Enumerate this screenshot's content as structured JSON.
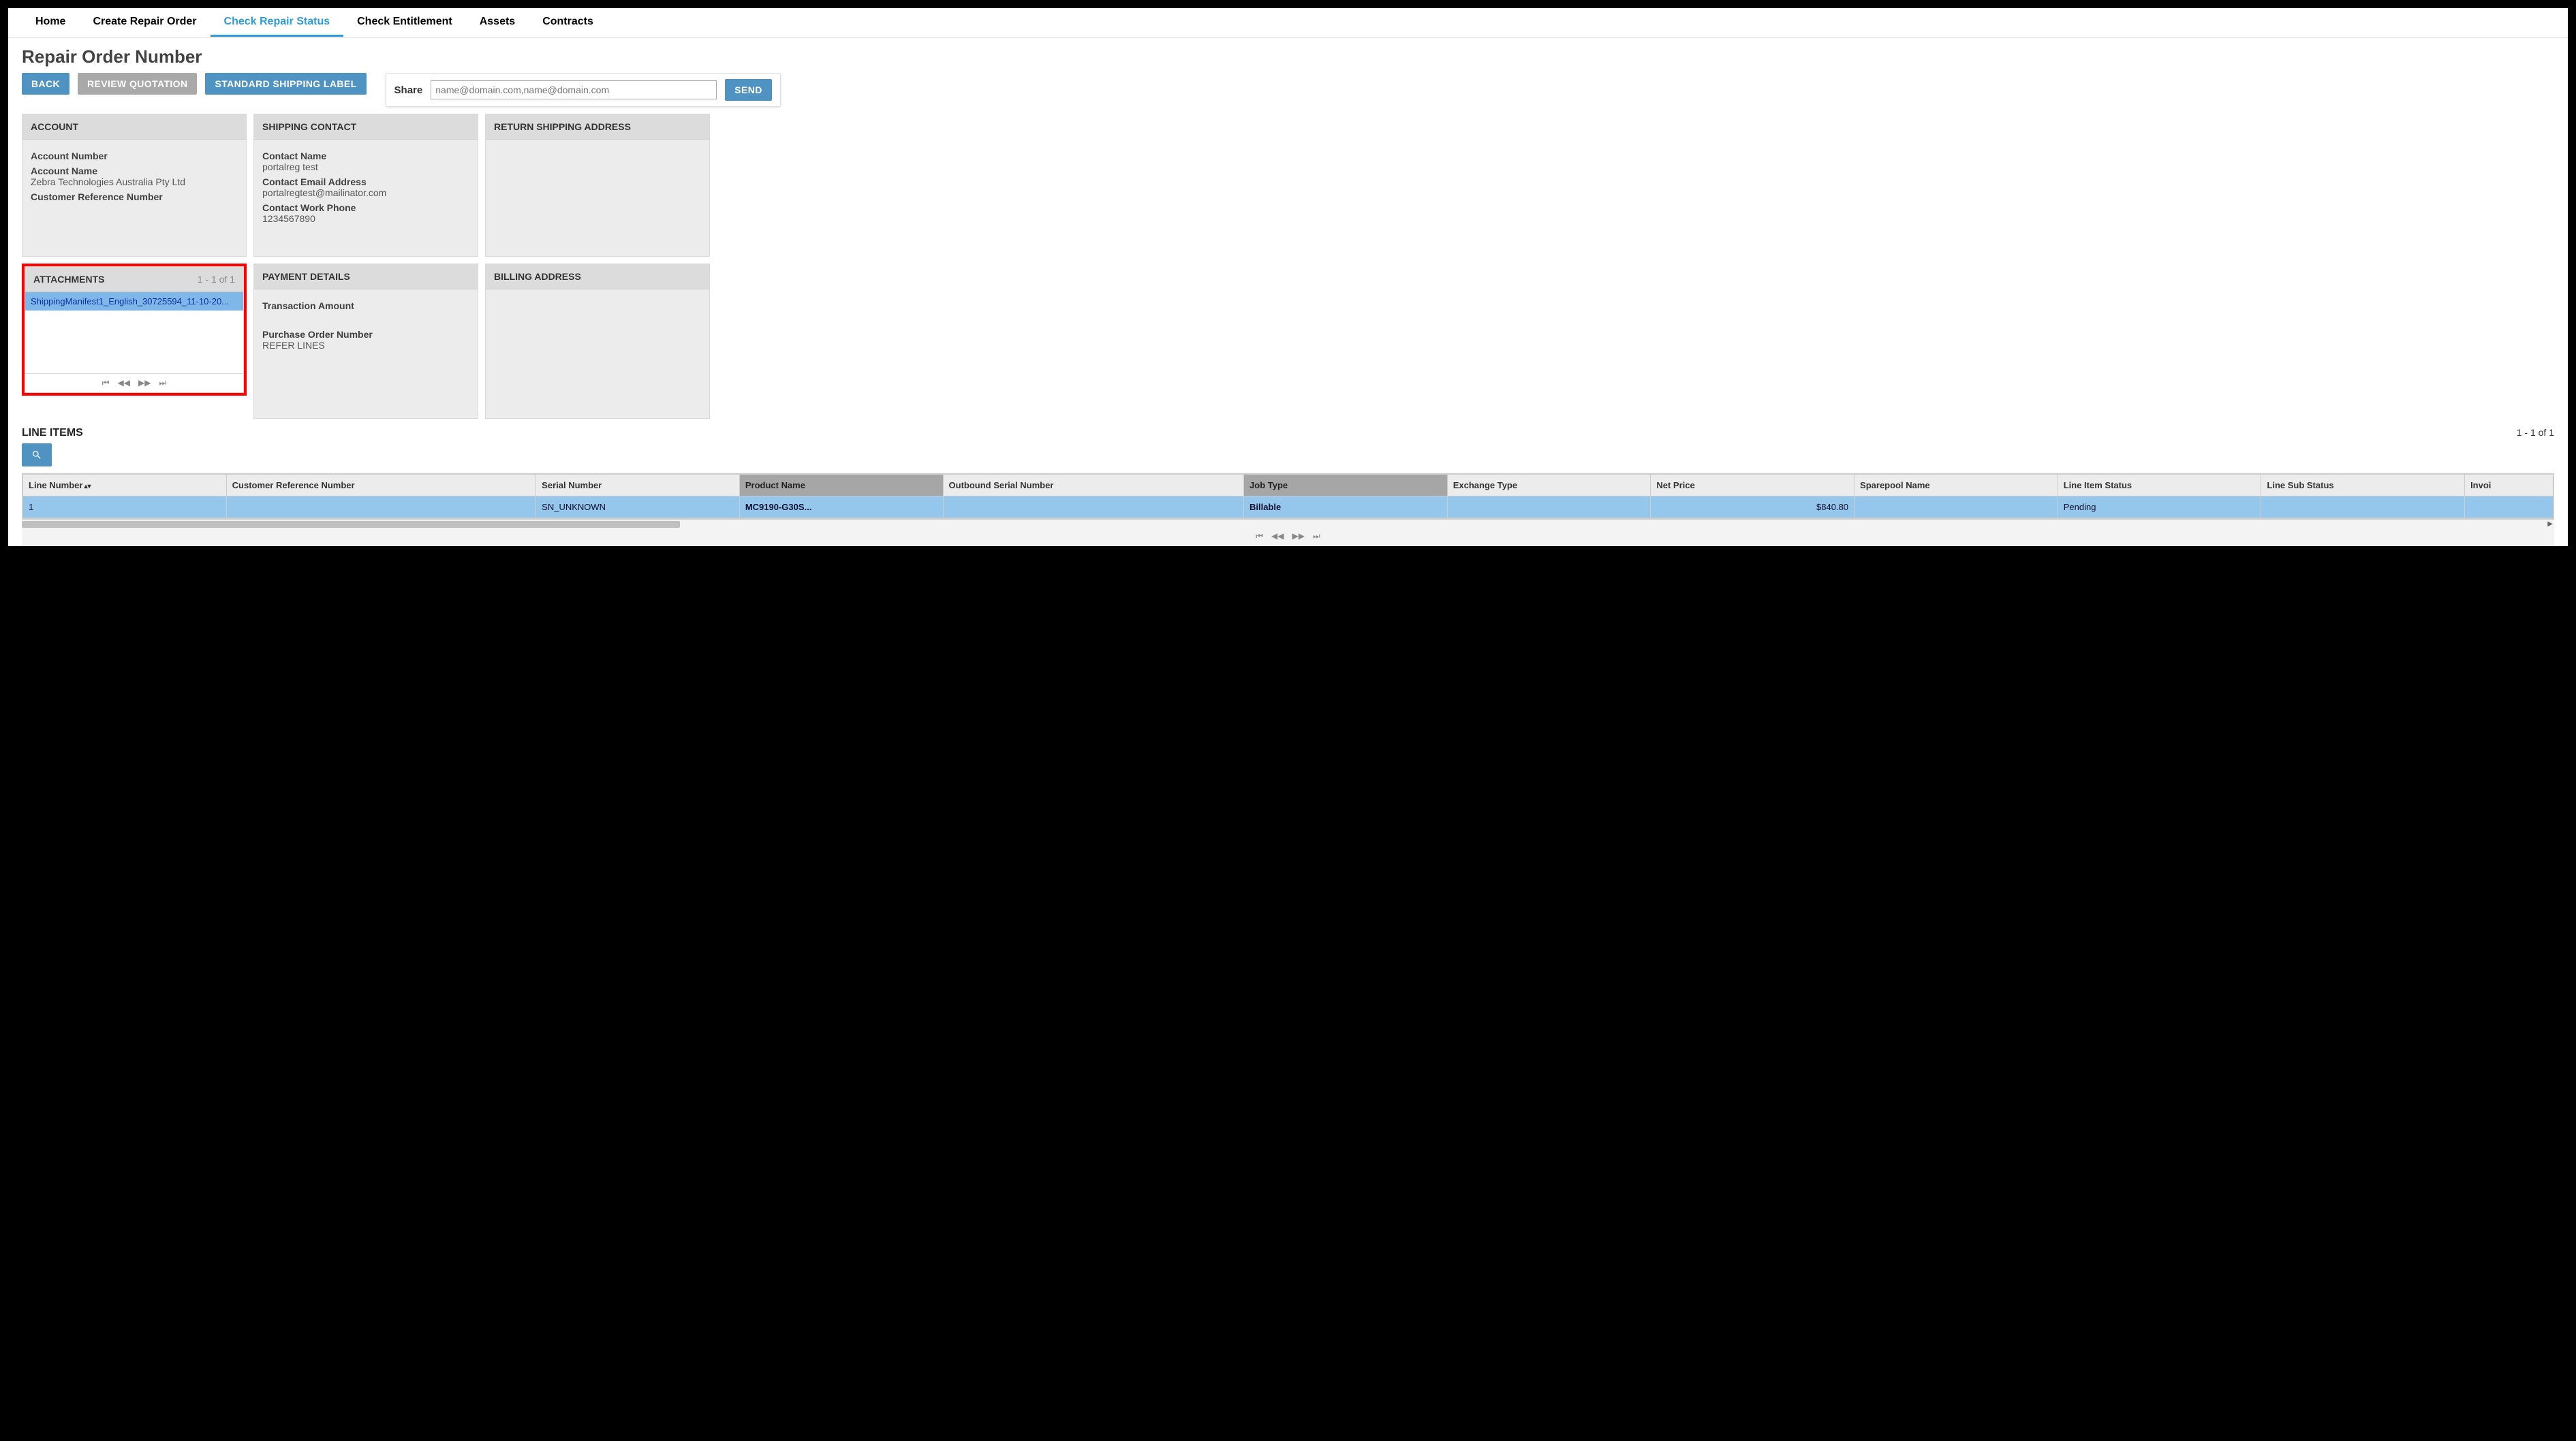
{
  "nav": {
    "items": [
      {
        "label": "Home"
      },
      {
        "label": "Create Repair Order"
      },
      {
        "label": "Check Repair Status",
        "active": true
      },
      {
        "label": "Check Entitlement"
      },
      {
        "label": "Assets"
      },
      {
        "label": "Contracts"
      }
    ]
  },
  "page_title": "Repair Order Number",
  "toolbar": {
    "back": "BACK",
    "review_quotation": "REVIEW QUOTATION",
    "shipping_label": "STANDARD SHIPPING LABEL",
    "share_label": "Share",
    "share_placeholder": "name@domain.com,name@domain.com",
    "send": "SEND"
  },
  "panels": {
    "account": {
      "title": "ACCOUNT",
      "account_number_label": "Account Number",
      "account_number_value": "",
      "account_name_label": "Account Name",
      "account_name_value": "Zebra Technologies Australia Pty Ltd",
      "cust_ref_label": "Customer Reference Number",
      "cust_ref_value": ""
    },
    "shipping_contact": {
      "title": "SHIPPING CONTACT",
      "contact_name_label": "Contact Name",
      "contact_name_value": "portalreg test",
      "email_label": "Contact Email Address",
      "email_value": "portalregtest@mailinator.com",
      "phone_label": "Contact Work Phone",
      "phone_value": "1234567890"
    },
    "return_shipping": {
      "title": "RETURN SHIPPING ADDRESS"
    },
    "attachments": {
      "title": "ATTACHMENTS",
      "count": "1 - 1 of 1",
      "items": [
        "ShippingManifest1_English_30725594_11-10-20..."
      ]
    },
    "payment": {
      "title": "PAYMENT DETAILS",
      "txn_label": "Transaction Amount",
      "txn_value": "",
      "po_label": "Purchase Order Number",
      "po_value": "REFER LINES"
    },
    "billing": {
      "title": "BILLING ADDRESS"
    }
  },
  "line_items": {
    "title": "LINE ITEMS",
    "count": "1 - 1 of 1",
    "columns": [
      "Line Number",
      "Customer Reference Number",
      "Serial Number",
      "Product Name",
      "Outbound Serial Number",
      "Job Type",
      "Exchange Type",
      "Net Price",
      "Sparepool Name",
      "Line Item Status",
      "Line Sub Status",
      "Invoi"
    ],
    "rows": [
      {
        "line_number": "1",
        "cust_ref": "",
        "serial": "SN_UNKNOWN",
        "product": "MC9190-G30S...",
        "outbound_serial": "",
        "job_type": "Billable",
        "exchange_type": "",
        "net_price": "$840.80",
        "sparepool": "",
        "line_status": "Pending",
        "sub_status": "",
        "invoice": ""
      }
    ]
  }
}
